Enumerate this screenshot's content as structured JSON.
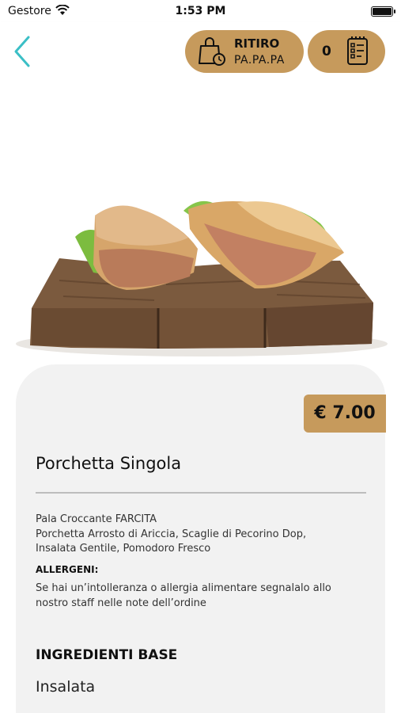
{
  "status_bar": {
    "carrier": "Gestore",
    "time": "1:53 PM"
  },
  "header": {
    "pickup": {
      "line1": "RITIRO",
      "line2": "PA.PA.PA"
    },
    "cart": {
      "count": "0"
    }
  },
  "product": {
    "price": "€ 7.00",
    "name": "Porchetta Singola",
    "description": [
      "Pala Croccante FARCITA",
      "Porchetta Arrosto di Ariccia, Scaglie di Pecorino Dop,",
      "Insalata Gentile, Pomodoro Fresco"
    ],
    "allergens_title": "ALLERGENI:",
    "allergens_text": [
      "Se hai un’intolleranza o allergia alimentare segnalalo allo",
      "nostro staff nelle note dell’ordine"
    ]
  },
  "ingredients": {
    "title": "INGREDIENTI BASE",
    "items": [
      "Insalata"
    ]
  },
  "colors": {
    "accent": "#c69a5c",
    "back_arrow": "#3bbfc6",
    "panel": "#f2f2f2"
  },
  "icons": [
    "wifi-icon",
    "battery-icon",
    "back-chevron-icon",
    "shopping-bag-clock-icon",
    "order-list-icon"
  ]
}
